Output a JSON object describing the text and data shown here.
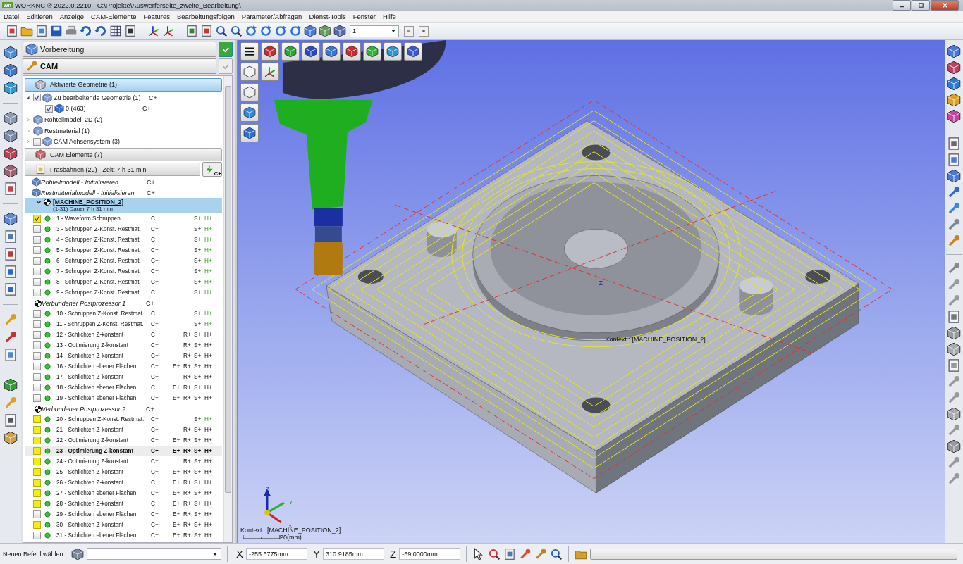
{
  "window": {
    "app_icon": "Wn",
    "title": "WORKNC ® 2022.0.2210 - C:\\Projekte\\Auswerferseite_zweite_Bearbeitung\\"
  },
  "menu": [
    "Datei",
    "Editieren",
    "Anzeige",
    "CAM-Elemente",
    "Features",
    "Bearbeitungsfolgen",
    "Parameter/Abfragen",
    "Dienst-Tools",
    "Fenster",
    "Hilfe"
  ],
  "toolbar": {
    "combo_value": "1"
  },
  "panel": {
    "prep_title": "Vorbereitung",
    "cam_title": "CAM",
    "geometry_header": "Aktivierte Geometrie (1)",
    "geometry_tree": [
      {
        "label": "Zu bearbeitende Geometrie (1)",
        "c": "C+",
        "expanded": true,
        "checked": true,
        "children": [
          {
            "label": "0 (463)",
            "c": "C+",
            "checked": true
          }
        ]
      },
      {
        "label": "Rohteilmodell 2D (2)",
        "expanded": false
      },
      {
        "label": "Restmaterial (1)",
        "expanded": false
      },
      {
        "label": "CAM Achsensystem (3)",
        "expanded": false,
        "checked": false
      }
    ],
    "elements_header": "CAM Elemente (7)",
    "toolpaths_header": "Fräsbahnen (29) - Zeit: 7 h 31 min",
    "calc_button": "C+",
    "init_rows": [
      {
        "label": "Rohteilmodell - Initialisieren",
        "c": "C+"
      },
      {
        "label": "Restmaterialmodell - Initialisieren",
        "c": "C+"
      }
    ],
    "machine": {
      "label": "[MACHINE_POSITION_2]",
      "sub": "(1-31) Dauer 7 h 31 min",
      "expanded": true
    },
    "rows": [
      {
        "kind": "op",
        "label": "1 - Waveform Schruppen",
        "checked": true,
        "flagged": true,
        "selected": false,
        "c": "C+",
        "s": "S+",
        "h": "H+",
        "h_active": true
      },
      {
        "kind": "op",
        "label": "3 - Schruppen Z-Konst. Restmat.",
        "checked": false,
        "flagged": false,
        "selected": false,
        "c": "C+",
        "s": "S+",
        "h": "H+",
        "h_active": true
      },
      {
        "kind": "op",
        "label": "4 - Schruppen Z-Konst. Restmat.",
        "checked": false,
        "flagged": false,
        "selected": false,
        "c": "C+",
        "s": "S+",
        "h": "H+",
        "h_active": true
      },
      {
        "kind": "op",
        "label": "5 - Schruppen Z-Konst. Restmat.",
        "checked": false,
        "flagged": false,
        "selected": false,
        "c": "C+",
        "s": "S+",
        "h": "H+",
        "h_active": true
      },
      {
        "kind": "op",
        "label": "6 - Schruppen Z-Konst. Restmat.",
        "checked": false,
        "flagged": false,
        "selected": false,
        "c": "C+",
        "s": "S+",
        "h": "H+",
        "h_active": true
      },
      {
        "kind": "op",
        "label": "7 - Schruppen Z-Konst. Restmat.",
        "checked": false,
        "flagged": false,
        "selected": false,
        "c": "C+",
        "s": "S+",
        "h": "H+",
        "h_active": true
      },
      {
        "kind": "op",
        "label": "8 - Schruppen Z-Konst. Restmat.",
        "checked": false,
        "flagged": false,
        "selected": false,
        "c": "C+",
        "s": "S+",
        "h": "H+",
        "h_active": true
      },
      {
        "kind": "op",
        "label": "9 - Schruppen Z-Konst. Restmat.",
        "checked": false,
        "flagged": false,
        "selected": false,
        "c": "C+",
        "s": "S+",
        "h": "H+",
        "h_active": true
      },
      {
        "kind": "post",
        "label": "Verbundener Postprozessor 1",
        "c": "C+"
      },
      {
        "kind": "op",
        "label": "10 - Schruppen Z-Konst. Restmat.",
        "checked": false,
        "flagged": false,
        "selected": false,
        "c": "C+",
        "s": "S+",
        "h": "H+",
        "h_active": true
      },
      {
        "kind": "op",
        "label": "11 - Schruppen Z-Konst. Restmat.",
        "checked": false,
        "flagged": false,
        "selected": false,
        "c": "C+",
        "s": "S+",
        "h": "H+",
        "h_active": true
      },
      {
        "kind": "op",
        "label": "12 - Schlichten Z-konstant",
        "checked": false,
        "flagged": false,
        "selected": false,
        "c": "C+",
        "r": "R+",
        "s": "S+",
        "h": "H+",
        "h_active": false
      },
      {
        "kind": "op",
        "label": "13 - Optimierung Z-konstant",
        "checked": false,
        "flagged": false,
        "selected": false,
        "c": "C+",
        "r": "R+",
        "s": "S+",
        "h": "H+",
        "h_active": false
      },
      {
        "kind": "op",
        "label": "14 - Schlichten Z-konstant",
        "checked": false,
        "flagged": false,
        "selected": false,
        "c": "C+",
        "r": "R+",
        "s": "S+",
        "h": "H+",
        "h_active": false
      },
      {
        "kind": "op",
        "label": "16 - Schlichten ebener Flächen",
        "checked": false,
        "flagged": false,
        "selected": false,
        "c": "C+",
        "e": "E+",
        "r": "R+",
        "s": "S+",
        "h": "H+",
        "h_active": false
      },
      {
        "kind": "op",
        "label": "17 - Schlichten Z-konstant",
        "checked": false,
        "flagged": false,
        "selected": false,
        "c": "C+",
        "r": "R+",
        "s": "S+",
        "h": "H+",
        "h_active": false
      },
      {
        "kind": "op",
        "label": "18 - Schlichten ebener Flächen",
        "checked": false,
        "flagged": false,
        "selected": false,
        "c": "C+",
        "e": "E+",
        "r": "R+",
        "s": "S+",
        "h": "H+",
        "h_active": false
      },
      {
        "kind": "op",
        "label": "19 - Schlichten ebener Flächen",
        "checked": false,
        "flagged": false,
        "selected": false,
        "c": "C+",
        "e": "E+",
        "r": "R+",
        "s": "S+",
        "h": "H+",
        "h_active": false
      },
      {
        "kind": "post",
        "label": "Verbundener Postprozessor 2",
        "c": "C+"
      },
      {
        "kind": "op",
        "label": "20 - Schruppen Z-Konst. Restmat.",
        "checked": false,
        "flagged": true,
        "selected": false,
        "c": "C+",
        "s": "S+",
        "h": "H+",
        "h_active": true
      },
      {
        "kind": "op",
        "label": "21 - Schlichten Z-konstant",
        "checked": false,
        "flagged": true,
        "selected": false,
        "c": "C+",
        "r": "R+",
        "s": "S+",
        "h": "H+",
        "h_active": false
      },
      {
        "kind": "op",
        "label": "22 - Optimierung Z-konstant",
        "checked": false,
        "flagged": true,
        "selected": false,
        "c": "C+",
        "e": "E+",
        "r": "R+",
        "s": "S+",
        "h": "H+",
        "h_active": false
      },
      {
        "kind": "op",
        "label": "23 - Optimierung Z-konstant",
        "checked": false,
        "flagged": true,
        "selected": true,
        "c": "C+",
        "e": "E+",
        "r": "R+",
        "s": "S+",
        "h": "H+",
        "h_active": false
      },
      {
        "kind": "op",
        "label": "24 - Optimierung Z-konstant",
        "checked": false,
        "flagged": true,
        "selected": false,
        "c": "C+",
        "r": "R+",
        "s": "S+",
        "h": "H+",
        "h_active": false
      },
      {
        "kind": "op",
        "label": "25 - Schlichten Z-konstant",
        "checked": false,
        "flagged": true,
        "selected": false,
        "c": "C+",
        "e": "E+",
        "r": "R+",
        "s": "S+",
        "h": "H+",
        "h_active": false
      },
      {
        "kind": "op",
        "label": "26 - Schlichten Z-konstant",
        "checked": false,
        "flagged": true,
        "selected": false,
        "c": "C+",
        "e": "E+",
        "r": "R+",
        "s": "S+",
        "h": "H+",
        "h_active": false
      },
      {
        "kind": "op",
        "label": "27 - Schlichten ebener Flächen",
        "checked": false,
        "flagged": true,
        "selected": false,
        "c": "C+",
        "e": "E+",
        "r": "R+",
        "s": "S+",
        "h": "H+",
        "h_active": false
      },
      {
        "kind": "op",
        "label": "28 - Schlichten Z-konstant",
        "checked": false,
        "flagged": true,
        "selected": false,
        "c": "C+",
        "e": "E+",
        "r": "R+",
        "s": "S+",
        "h": "H+",
        "h_active": false
      },
      {
        "kind": "op",
        "label": "29 - Schlichten ebener Flächen",
        "checked": false,
        "flagged": false,
        "selected": false,
        "c": "C+",
        "e": "E+",
        "r": "R+",
        "s": "S+",
        "h": "H+",
        "h_active": false
      },
      {
        "kind": "op",
        "label": "30 - Schlichten Z-konstant",
        "checked": false,
        "flagged": true,
        "selected": false,
        "c": "C+",
        "e": "E+",
        "r": "R+",
        "s": "S+",
        "h": "H+",
        "h_active": false
      },
      {
        "kind": "op",
        "label": "31 - Schlichten ebener Flächen",
        "checked": false,
        "flagged": false,
        "selected": false,
        "c": "C+",
        "e": "E+",
        "r": "R+",
        "s": "S+",
        "h": "H+",
        "h_active": false
      }
    ]
  },
  "viewport": {
    "context_labels": [
      "Kontext : [MACHINE_POSITION_2]",
      "Kontext : [MACHINE_POSITION_2]"
    ],
    "part_axis_label": "Z",
    "axis_labels": {
      "z": "Z",
      "y": "Y",
      "x": "X"
    },
    "scale_label": "20(mm)"
  },
  "status_bar": {
    "command_label": "Neuen Befehl wählen...",
    "x_label": "X",
    "x": "-255.6775mm",
    "y_label": "Y",
    "y": "310.9185mm",
    "z_label": "Z",
    "z": "-59.0000mm",
    "progress": {
      "level": 0
    }
  }
}
